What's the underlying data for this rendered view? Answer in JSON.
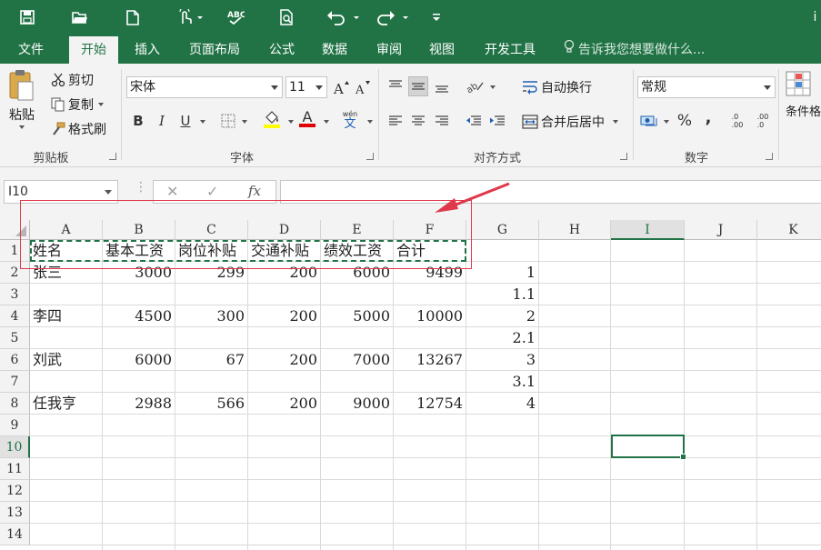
{
  "tabs": [
    {
      "label": "文件",
      "active": false
    },
    {
      "label": "开始",
      "active": true
    },
    {
      "label": "插入",
      "active": false
    },
    {
      "label": "页面布局",
      "active": false
    },
    {
      "label": "公式",
      "active": false
    },
    {
      "label": "数据",
      "active": false
    },
    {
      "label": "审阅",
      "active": false
    },
    {
      "label": "视图",
      "active": false
    },
    {
      "label": "开发工具",
      "active": false
    }
  ],
  "tell_me": "告诉我您想要做什么...",
  "title_fragment": "i",
  "clipboard": {
    "paste": "粘贴",
    "cut": "剪切",
    "copy": "复制",
    "format_painter": "格式刷",
    "group_label": "剪贴板"
  },
  "font": {
    "name": "宋体",
    "size": "11",
    "bold": "B",
    "italic": "I",
    "underline": "U",
    "font_color_letter": "A",
    "wen": "wén",
    "wen_char": "文",
    "group_label": "字体"
  },
  "alignment": {
    "wrap_text": "自动换行",
    "merge_center": "合并后居中",
    "group_label": "对齐方式"
  },
  "number": {
    "format": "常规",
    "percent": "%",
    "comma": ",",
    "inc_decimal": ".0\n.00",
    "dec_decimal": ".00\n.0",
    "group_label": "数字"
  },
  "styles": {
    "conditional": "条件格"
  },
  "namebox": "I10",
  "formula_icons": {
    "cancel": "✕",
    "enter": "✓",
    "fx": "fx"
  },
  "columns": [
    "A",
    "B",
    "C",
    "D",
    "E",
    "F",
    "G",
    "H",
    "I",
    "J",
    "K"
  ],
  "selected_column": "I",
  "rows": [
    "1",
    "2",
    "3",
    "4",
    "5",
    "6",
    "7",
    "8",
    "9",
    "10",
    "11",
    "12",
    "13",
    "14"
  ],
  "selected_row": "10",
  "cells": {
    "header": [
      "姓名",
      "基本工资",
      "岗位补贴",
      "交通补贴",
      "绩效工资",
      "合计"
    ],
    "r2": [
      "张三",
      "3000",
      "299",
      "200",
      "6000",
      "9499",
      "1"
    ],
    "r3": [
      "1.1"
    ],
    "r4": [
      "李四",
      "4500",
      "300",
      "200",
      "5000",
      "10000",
      "2"
    ],
    "r5": [
      "2.1"
    ],
    "r6": [
      "刘武",
      "6000",
      "67",
      "200",
      "7000",
      "13267",
      "3"
    ],
    "r7": [
      "3.1"
    ],
    "r8": [
      "任我亨",
      "2988",
      "566",
      "200",
      "9000",
      "12754",
      "4"
    ]
  },
  "colors": {
    "brand": "#217346",
    "annotation": "#e0384b"
  }
}
